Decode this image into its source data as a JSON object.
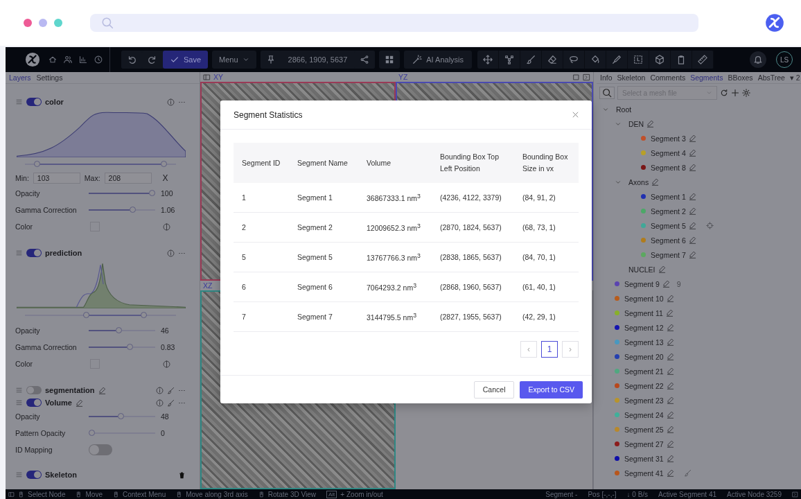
{
  "browser": {
    "dots": [
      {
        "color": "#ee5b96"
      },
      {
        "color": "#b9b9f2"
      },
      {
        "color": "#5fd6cd"
      }
    ]
  },
  "toolbar": {
    "save": "Save",
    "menu": "Menu",
    "position": "2866, 1909, 5637",
    "ai": "AI Analysis",
    "user": "LS"
  },
  "left_tabs": [
    {
      "label": "Layers",
      "selected": true
    },
    {
      "label": "Settings",
      "selected": false
    }
  ],
  "layers": [
    {
      "kind": "image",
      "name": "color",
      "on": true,
      "range": {
        "low": {
          "level": 0.06
        },
        "high": {
          "level": 0.94
        }
      },
      "min_label": "Min:",
      "min": "103",
      "max_label": "Max:",
      "max": "208",
      "clear": "X",
      "sliders": [
        {
          "label": "Opacity",
          "level": 1,
          "reading": "100"
        },
        {
          "label": "Gamma Correction",
          "level": 0.68,
          "reading": "1.06"
        }
      ],
      "color_label": "Color"
    },
    {
      "kind": "image",
      "name": "prediction",
      "on": true,
      "range": {
        "low": {
          "level": 0.4
        },
        "high": {
          "level": 0.8
        }
      },
      "sliders": [
        {
          "label": "Opacity",
          "level": 0.45,
          "reading": "46"
        },
        {
          "label": "Gamma Correction",
          "level": 0.63,
          "reading": "0.83"
        }
      ],
      "color_label": "Color"
    },
    {
      "kind": "segmentation",
      "name": "segmentation",
      "on": false
    },
    {
      "kind": "segmentation",
      "name": "Volume",
      "on": true,
      "sliders": [
        {
          "label": "Opacity",
          "level": 0.48,
          "reading": "48"
        },
        {
          "label": "Pattern Opacity",
          "level": 0,
          "reading": "0"
        }
      ],
      "mapping": {
        "label": "ID Mapping",
        "on": false
      }
    },
    {
      "kind": "skeleton",
      "name": "Skeleton",
      "on": true
    }
  ],
  "viewports": [
    {
      "label": "XY",
      "color": "#9a3a56"
    },
    {
      "label": "YZ",
      "color": "#4a4ab0"
    },
    {
      "label": "XZ",
      "color": "#2e8884"
    },
    {
      "color": "#6e6e78"
    }
  ],
  "right_tabs": [
    {
      "label": "Info",
      "selected": false
    },
    {
      "label": "Skeleton",
      "selected": false
    },
    {
      "label": "Comments",
      "selected": false
    },
    {
      "label": "Segments",
      "selected": true
    },
    {
      "label": "BBoxes",
      "selected": false
    },
    {
      "label": "AbsTree",
      "selected": false
    },
    {
      "label": "▾ 2",
      "selected": false
    }
  ],
  "mesh_select": {
    "placeholder": "Select a mesh file"
  },
  "tree": {
    "label": "Root",
    "expanded": true,
    "children": [
      {
        "label": "DEN",
        "expanded": true,
        "children": [
          {
            "label": "Segment 3",
            "color": "#c0502a"
          },
          {
            "label": "Segment 4",
            "color": "#b8a028"
          },
          {
            "label": "Segment 8",
            "color": "#7a1616"
          }
        ]
      },
      {
        "label": "Axons",
        "expanded": true,
        "children": [
          {
            "label": "Segment 1",
            "color": "#2030b0"
          },
          {
            "label": "Segment 2",
            "color": "#4ca868"
          },
          {
            "label": "Segment 5",
            "color": "#40a898",
            "hovered": true
          },
          {
            "label": "Segment 6",
            "color": "#b07c1c"
          },
          {
            "label": "Segment 7",
            "color": "#5ca860"
          }
        ]
      },
      {
        "label": "NUCLEI"
      },
      {
        "label": "Segment 9",
        "color": "#5a44b0",
        "badge": "9"
      },
      {
        "label": "Segment 10",
        "color": "#b85c1c"
      },
      {
        "label": "Segment 11",
        "color": "#88b02a"
      },
      {
        "label": "Segment 12",
        "color": "#1414b0"
      },
      {
        "label": "Segment 13",
        "color": "#4898c0"
      },
      {
        "label": "Segment 20",
        "color": "#2440b0"
      },
      {
        "label": "Segment 21",
        "color": "#50a880"
      },
      {
        "label": "Segment 22",
        "color": "#b8481c"
      },
      {
        "label": "Segment 23",
        "color": "#b8942c"
      },
      {
        "label": "Segment 24",
        "color": "#40b09a"
      },
      {
        "label": "Segment 25",
        "color": "#b8882c"
      },
      {
        "label": "Segment 27",
        "color": "#8c1c1c"
      },
      {
        "label": "Segment 31",
        "color": "#0e0ea8"
      },
      {
        "label": "Segment 41",
        "color": "#b8561c",
        "active": true
      }
    ]
  },
  "status_bar": [
    {
      "kind": "mouse",
      "text": "Select Node"
    },
    {
      "kind": "mouse",
      "text": "Move"
    },
    {
      "kind": "mouse",
      "text": "Context Menu"
    },
    {
      "kind": "mouse",
      "text": "Move along 3rd axis"
    },
    {
      "kind": "mouse",
      "text": "Rotate 3D View"
    },
    {
      "kind": "key",
      "key": "Alt",
      "text": "+ Zoom in/out"
    },
    {
      "kind": "plain",
      "text": "Segment -"
    },
    {
      "kind": "plain",
      "text": "Pos [-,-,-]"
    },
    {
      "kind": "plain",
      "text": "↓ 0 B/s"
    },
    {
      "kind": "plain",
      "text": "Active Segment 41"
    },
    {
      "kind": "plain",
      "text": "Active Node 3259"
    }
  ],
  "dialog": {
    "title": "Segment Statistics",
    "columns": [
      "Segment ID",
      "Segment Name",
      "Volume",
      "Bounding Box Top Left Position",
      "Bounding Box Size in vx"
    ],
    "rows": [
      [
        "1",
        "Segment 1",
        "36867333.1 nm$^{3}$",
        "(4236, 4122, 3379)",
        "(84, 91, 2)"
      ],
      [
        "2",
        "Segment 2",
        "12009652.3 nm$^{3}$",
        "(2870, 1824, 5637)",
        "(68, 73, 1)"
      ],
      [
        "5",
        "Segment 5",
        "13767766.3 nm$^{3}$",
        "(2838, 1865, 5637)",
        "(84, 70, 1)"
      ],
      [
        "6",
        "Segment 6",
        "7064293.2 nm$^{3}$",
        "(2868, 1960, 5637)",
        "(61, 40, 1)"
      ],
      [
        "7",
        "Segment 7",
        "3144795.5 nm$^{3}$",
        "(2827, 1955, 5637)",
        "(42, 29, 1)"
      ]
    ],
    "pagination": {
      "prev": "‹",
      "pages": [
        {
          "label": "1",
          "selected": true
        }
      ],
      "next": "›"
    },
    "cancel": "Cancel",
    "export": "Export to CSV"
  }
}
